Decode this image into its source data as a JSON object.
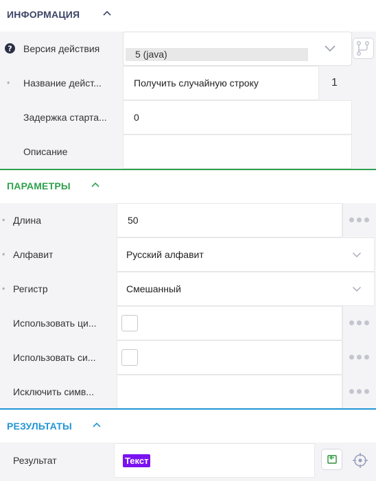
{
  "info": {
    "title": "ИНФОРМАЦИЯ",
    "version_label": "Версия действия",
    "version_value": "5 (java)",
    "name_label": "Название дейст...",
    "name_value": "Получить случайную строку",
    "name_counter": "1",
    "delay_label": "Задержка старта...",
    "delay_value": "0",
    "description_label": "Описание",
    "description_value": ""
  },
  "params": {
    "title": "ПАРАМЕТРЫ",
    "length_label": "Длина",
    "length_value": "50",
    "alphabet_label": "Алфавит",
    "alphabet_value": "Русский алфавит",
    "case_label": "Регистр",
    "case_value": "Смешанный",
    "use_digits_label": "Использовать ци...",
    "use_symbols_label": "Использовать си...",
    "exclude_label": "Исключить симв...",
    "exclude_value": ""
  },
  "results": {
    "title": "РЕЗУЛЬТАТЫ",
    "result_label": "Результат",
    "result_badge": "Текст"
  },
  "colors": {
    "info_title": "#3d4566",
    "params_accent": "#2ea14c",
    "results_accent": "#2196d6",
    "badge_bg": "#7a12f0"
  }
}
